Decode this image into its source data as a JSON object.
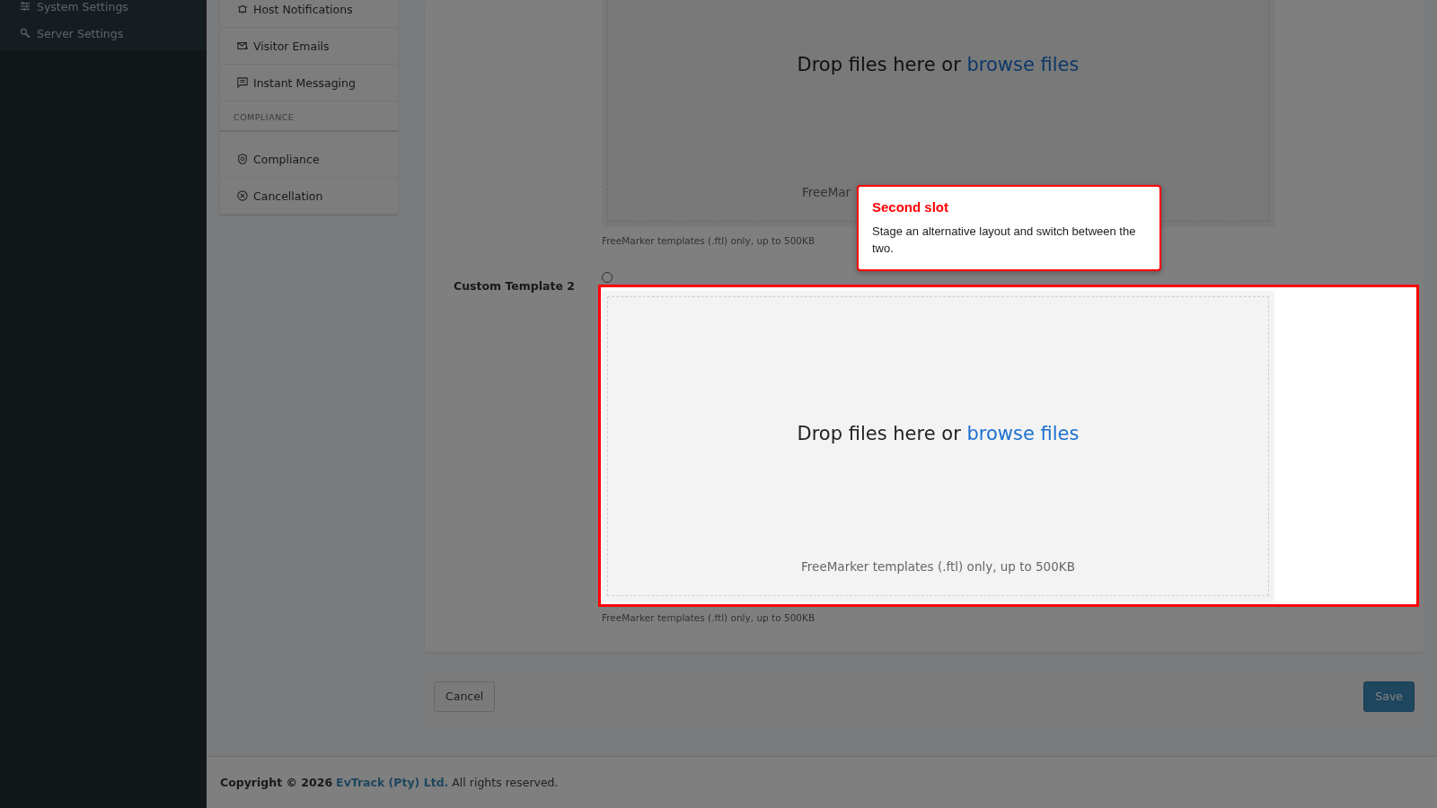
{
  "sidebar": {
    "items": [
      {
        "label": "System Settings"
      },
      {
        "label": "Server Settings"
      }
    ]
  },
  "submenu": {
    "groups": [
      {
        "items": [
          {
            "label": "Host Notifications"
          },
          {
            "label": "Visitor Emails"
          },
          {
            "label": "Instant Messaging"
          }
        ]
      },
      {
        "heading": "COMPLIANCE",
        "items": [
          {
            "label": "Compliance"
          },
          {
            "label": "Cancellation"
          }
        ]
      }
    ]
  },
  "templates": [
    {
      "drop_text": "Drop files here or",
      "browse_link": "browse files",
      "hint": "FreeMar",
      "help": "FreeMarker templates (.ftl) only, up to 500KB"
    },
    {
      "label": "Custom Template 2",
      "selected": false,
      "drop_text": "Drop files here or",
      "browse_link": "browse files",
      "hint": "FreeMarker templates (.ftl) only, up to 500KB",
      "help": "FreeMarker templates (.ftl) only, up to 500KB"
    }
  ],
  "buttons": {
    "cancel": "Cancel",
    "save": "Save"
  },
  "footer": {
    "prefix": "Copyright © 2026",
    "company": "EvTrack (Pty) Ltd.",
    "suffix": "All rights reserved."
  },
  "tooltip": {
    "title": "Second slot",
    "body": "Stage an alternative layout and switch between the two."
  }
}
